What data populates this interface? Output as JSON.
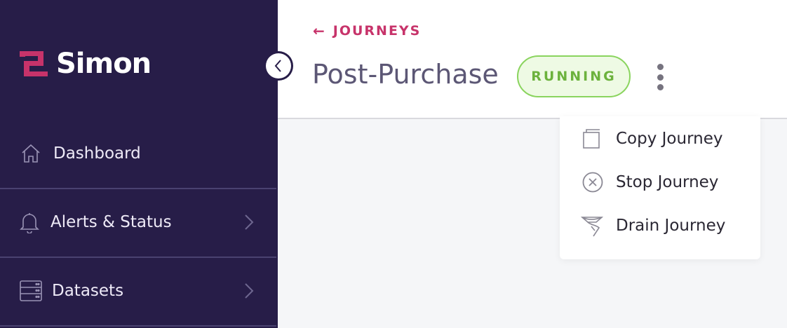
{
  "app": {
    "name": "Simon"
  },
  "sidebar": {
    "items": [
      {
        "label": "Dashboard",
        "icon": "home-icon",
        "has_chevron": false
      },
      {
        "label": "Alerts & Status",
        "icon": "bell-icon",
        "has_chevron": true
      },
      {
        "label": "Datasets",
        "icon": "database-icon",
        "has_chevron": true
      }
    ],
    "collapse_icon": "chevron-left-icon"
  },
  "header": {
    "back_label": "JOURNEYS",
    "back_arrow": "←",
    "title": "Post-Purchase",
    "status": "RUNNING",
    "menu_icon": "kebab-menu-icon"
  },
  "menu": {
    "items": [
      {
        "label": "Copy Journey",
        "icon": "copy-icon"
      },
      {
        "label": "Stop Journey",
        "icon": "stop-circle-icon"
      },
      {
        "label": "Drain Journey",
        "icon": "funnel-icon"
      }
    ]
  },
  "colors": {
    "sidebar_bg": "#271d48",
    "accent": "#c7336a",
    "status_green": "#6cb23d",
    "status_bg": "#eefae4"
  }
}
